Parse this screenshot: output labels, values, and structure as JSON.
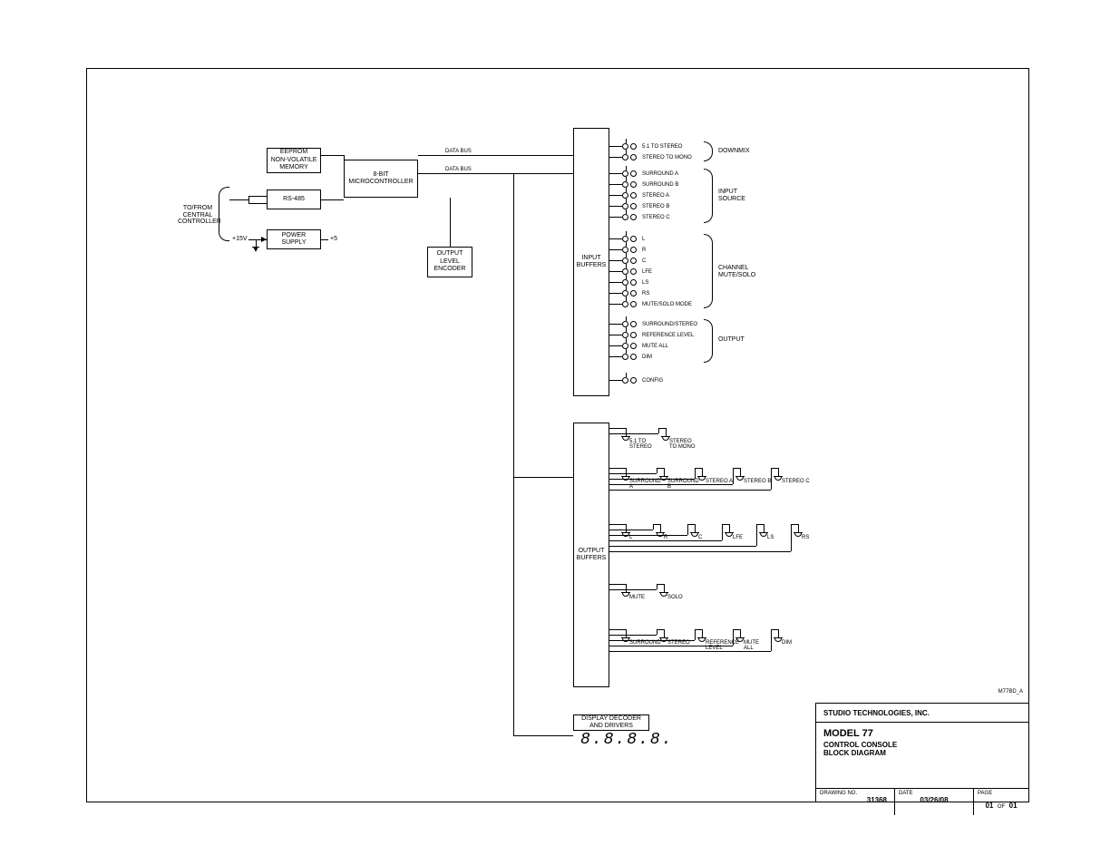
{
  "external": {
    "to_from": "TO/FROM\nCENTRAL\nCONTROLLER",
    "p15v": "+15V",
    "p5": "+5"
  },
  "blocks": {
    "eeprom": "EEPROM\nNON-VOLATILE\nMEMORY",
    "rs485": "RS-485",
    "psu": "POWER\nSUPPLY",
    "mcu": "8-BIT\nMICROCONTROLLER",
    "encoder": "OUTPUT\nLEVEL\nENCODER",
    "in_buf": "INPUT\nBUFFERS",
    "out_buf": "OUTPUT\nBUFFERS",
    "disp": "DISPLAY DECODER\nAND DRIVERS",
    "data_bus1": "DATA BUS",
    "data_bus2": "DATA BUS"
  },
  "groups": {
    "downmix": "DOWNMIX",
    "input_source": "INPUT\nSOURCE",
    "chan_ms": "CHANNEL\nMUTE/SOLO",
    "output": "OUTPUT"
  },
  "sw_downmix": [
    "5.1 TO STEREO",
    "STEREO TO MONO"
  ],
  "sw_input_source": [
    "SURROUND A",
    "SURROUND B",
    "STEREO A",
    "STEREO B",
    "STEREO C"
  ],
  "sw_chan": [
    "L",
    "R",
    "C",
    "LFE",
    "LS",
    "RS",
    "MUTE/SOLO MODE"
  ],
  "sw_output": [
    "SURROUND/STEREO",
    "REFERENCE LEVEL",
    "MUTE ALL",
    "DIM"
  ],
  "sw_config": "CONFIG",
  "led_row1": [
    {
      "l1": "5.1 TO",
      "l2": "STEREO"
    },
    {
      "l1": "STEREO",
      "l2": "TO MONO"
    }
  ],
  "led_row2": [
    {
      "l1": "SURROUND",
      "l2": "A"
    },
    {
      "l1": "SURROUND",
      "l2": "B"
    },
    {
      "l1": "STEREO A",
      "l2": ""
    },
    {
      "l1": "STEREO B",
      "l2": ""
    },
    {
      "l1": "STEREO C",
      "l2": ""
    }
  ],
  "led_row3": [
    {
      "l1": "L"
    },
    {
      "l1": "R"
    },
    {
      "l1": "C"
    },
    {
      "l1": "LFE"
    },
    {
      "l1": "LS"
    },
    {
      "l1": "RS"
    }
  ],
  "led_row4": [
    {
      "l1": "MUTE"
    },
    {
      "l1": "SOLO"
    }
  ],
  "led_row5": [
    {
      "l1": "SURROUND"
    },
    {
      "l1": "STEREO"
    },
    {
      "l1": "REFERENCE",
      "l2": "LEVEL"
    },
    {
      "l1": "MUTE",
      "l2": "ALL"
    },
    {
      "l1": "DIM"
    }
  ],
  "seven_seg": "8.8.8.8.",
  "doc_code": "M77BD_A",
  "title_block": {
    "company": "STUDIO TECHNOLOGIES, INC.",
    "model": "MODEL 77",
    "line2": "CONTROL CONSOLE",
    "line3": "BLOCK DIAGRAM",
    "dwg_lbl": "DRAWING NO.",
    "dwg_no": "31368",
    "date_lbl": "DATE",
    "date": "03/26/08",
    "page_lbl": "PAGE",
    "page": "01",
    "of": "OF",
    "pages": "01"
  }
}
